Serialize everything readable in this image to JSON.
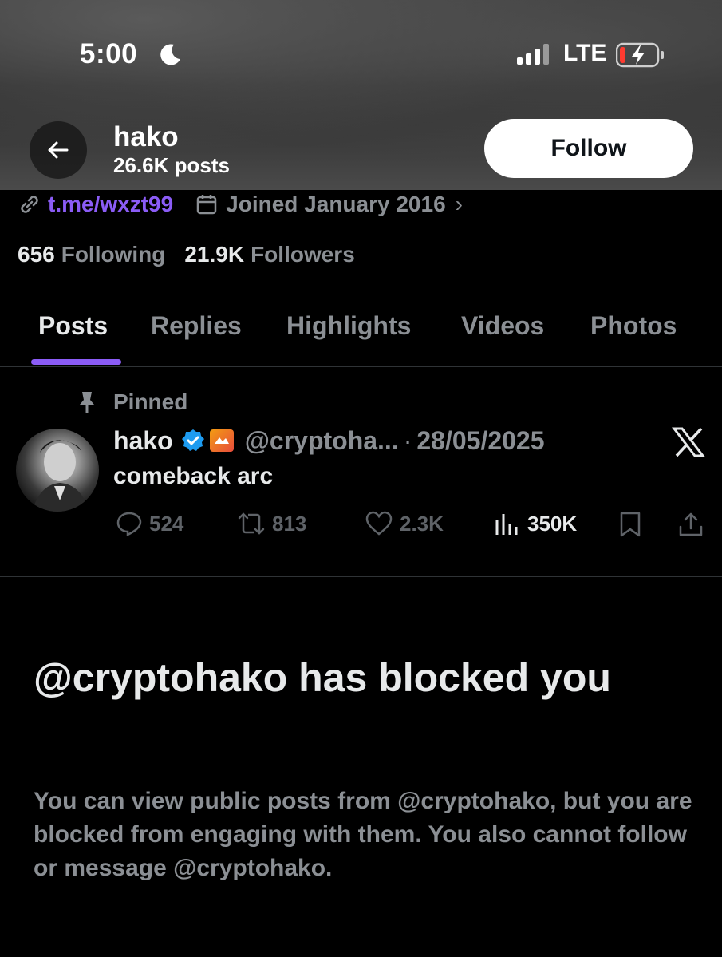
{
  "status_bar": {
    "time": "5:00",
    "network": "LTE"
  },
  "header": {
    "name": "hako",
    "posts": "26.6K posts",
    "follow_label": "Follow"
  },
  "profile": {
    "link": "t.me/wxzt99",
    "joined": "Joined January 2016",
    "following_count": "656",
    "following_label": "Following",
    "followers_count": "21.9K",
    "followers_label": "Followers"
  },
  "tabs": [
    {
      "label": "Posts",
      "active": true
    },
    {
      "label": "Replies"
    },
    {
      "label": "Highlights"
    },
    {
      "label": "Videos"
    },
    {
      "label": "Photos"
    }
  ],
  "pinned_post": {
    "pinned_label": "Pinned",
    "author": "hako",
    "handle": "@cryptoha...",
    "separator": "·",
    "date": "28/05/2025",
    "text": "comeback arc",
    "replies": "524",
    "reposts": "813",
    "likes": "2.3K",
    "views": "350K"
  },
  "blocked": {
    "title": "@cryptohako has blocked you",
    "description": "You can view public posts from @cryptohako, but you are blocked from engaging with them. You also cannot follow or message @cryptohako."
  },
  "colors": {
    "accent": "#8b5cf6",
    "verified": "#1d9bf0",
    "muted": "#8b8f94"
  }
}
